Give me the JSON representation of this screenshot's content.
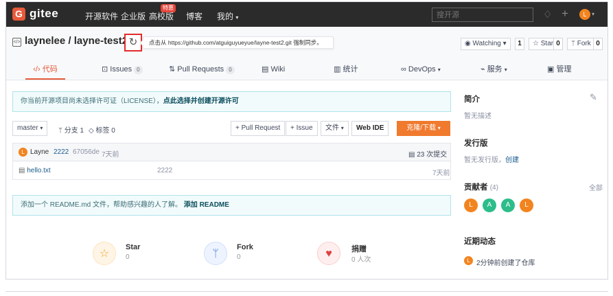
{
  "topnav": {
    "brand": "gitee",
    "logo_letter": "G",
    "items": [
      "开源软件",
      "企业版",
      "高校版",
      "博客",
      "我的"
    ],
    "hot_badge": "特惠",
    "search_placeholder": "搜开源",
    "avatar_letter": "L"
  },
  "repo": {
    "title": "laynelee / layne-test2",
    "sync_tip": "点击从 https://github.com/atguiguyueyue/layne-test2.git 强制同步。",
    "watch_label": "Watching",
    "watch_count": "1",
    "star_label": "Star",
    "star_count": "0",
    "fork_label": "Fork",
    "fork_count": "0"
  },
  "tabs": [
    {
      "label": "代码",
      "badge": "",
      "icon": "code-icon"
    },
    {
      "label": "Issues",
      "badge": "0",
      "icon": "issues-icon"
    },
    {
      "label": "Pull Requests",
      "badge": "0",
      "icon": "pull-request-icon"
    },
    {
      "label": "Wiki",
      "badge": "",
      "icon": "wiki-icon"
    },
    {
      "label": "统计",
      "badge": "",
      "icon": "chart-icon"
    },
    {
      "label": "DevOps",
      "badge": "",
      "icon": "devops-icon"
    },
    {
      "label": "服务",
      "badge": "",
      "icon": "service-icon"
    },
    {
      "label": "管理",
      "badge": "",
      "icon": "manage-icon"
    }
  ],
  "license": {
    "text": "你当前开源项目尚未选择许可证（LICENSE），",
    "link": "点此选择并创建开源许可"
  },
  "toolbar": {
    "branch": "master",
    "branches": "分支 1",
    "tags": "标签 0",
    "pull_request": "+ Pull Request",
    "issue": "+ Issue",
    "file": "文件",
    "webide": "Web IDE",
    "clone": "克隆/下载"
  },
  "commit": {
    "author": "Layne",
    "message": "2222",
    "hash": "67056de",
    "time": "7天前",
    "total": "23 次提交"
  },
  "files": [
    {
      "name": "hello.txt",
      "message": "2222",
      "time": "7天前"
    }
  ],
  "readme": {
    "text": "添加一个 README.md 文件，帮助感兴趣的人了解。",
    "link": "添加 README"
  },
  "stats": [
    {
      "label": "Star",
      "value": "0",
      "icon": "star-icon"
    },
    {
      "label": "Fork",
      "value": "0",
      "icon": "fork-icon"
    },
    {
      "label": "捐赠",
      "value": "0 人次",
      "icon": "donate-icon"
    }
  ],
  "sidebar": {
    "intro_title": "简介",
    "intro_text": "暂无描述",
    "release_title": "发行版",
    "release_text": "暂无发行版，",
    "release_link": "创建",
    "contrib_title": "贡献者",
    "contrib_count": "(4)",
    "contrib_all": "全部",
    "contributors": [
      "L",
      "A",
      "A",
      "L"
    ],
    "activity_title": "近期动态",
    "activity_text": "2分钟前创建了仓库"
  },
  "colors": {
    "accent": "#e65a3a",
    "clone": "#f07a2e",
    "contrib_orange": "#f2841f",
    "contrib_green": "#2dbd8a"
  }
}
